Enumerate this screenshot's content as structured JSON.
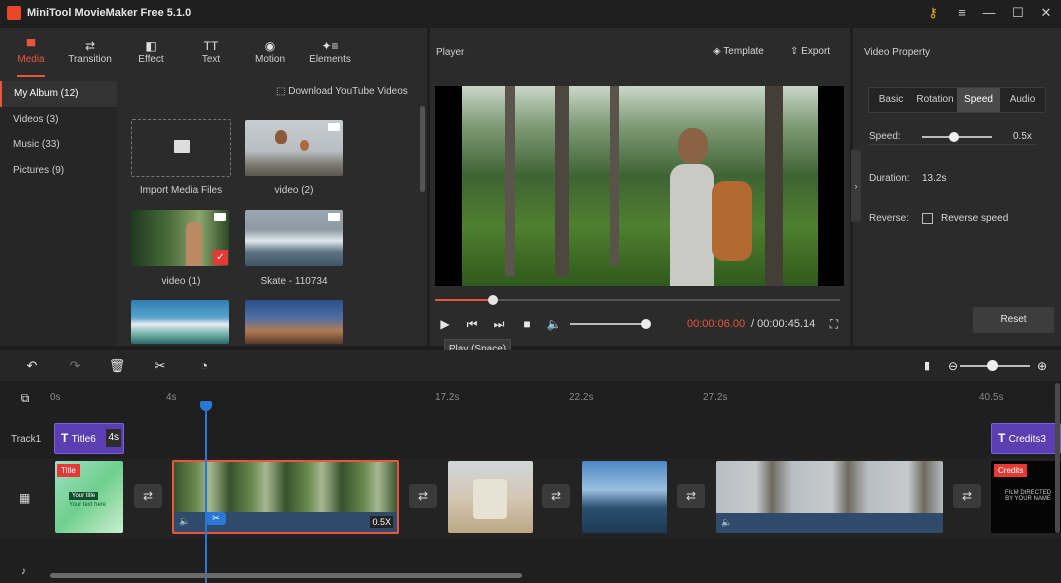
{
  "app": {
    "title": "MiniTool MovieMaker Free 5.1.0"
  },
  "window_controls": {
    "key": "⚷",
    "menu": "≡",
    "minimize": "—",
    "maximize": "☐",
    "close": "✕"
  },
  "toolbar": {
    "items": [
      {
        "label": "Media",
        "icon": "folder-icon",
        "glyph": "▀"
      },
      {
        "label": "Transition",
        "icon": "transition-arrows-icon",
        "glyph": "⇄"
      },
      {
        "label": "Effect",
        "icon": "effect-icon",
        "glyph": "◧"
      },
      {
        "label": "Text",
        "icon": "text-icon",
        "glyph": "TT"
      },
      {
        "label": "Motion",
        "icon": "motion-icon",
        "glyph": "◉"
      },
      {
        "label": "Elements",
        "icon": "elements-icon",
        "glyph": "✦≡"
      }
    ],
    "active": "Media"
  },
  "sidebar": {
    "items": [
      "My Album (12)",
      "Videos (3)",
      "Music (33)",
      "Pictures (9)"
    ]
  },
  "media": {
    "download_link": "Download YouTube Videos",
    "import_label": "Import Media Files",
    "items": [
      "video (2)",
      "video (1)",
      "Skate - 110734"
    ]
  },
  "player": {
    "label": "Player",
    "template": "Template",
    "export": "Export",
    "time_current": "00:00:06.00",
    "time_total": " / 00:00:45.14",
    "tooltip": "Play (Space)",
    "progress_fraction": 0.14
  },
  "properties": {
    "title": "Video Property",
    "tabs": [
      "Basic",
      "Rotation",
      "Speed",
      "Audio"
    ],
    "active_tab": "Speed",
    "speed_label": "Speed:",
    "speed_value": "0.5x",
    "duration_label": "Duration:",
    "duration_value": "13.2s",
    "reverse_label": "Reverse:",
    "reverse_option": "Reverse speed",
    "reset": "Reset"
  },
  "timeline": {
    "ruler": [
      "0s",
      "4s",
      "17.2s",
      "22.2s",
      "27.2s",
      "40.5s"
    ],
    "track_label": "Track1",
    "title_clip": {
      "name": "Title6",
      "duration": "4s"
    },
    "credits_clip": {
      "name": "Credits3"
    },
    "title_tag": "Title",
    "title_text_main": "Your title",
    "title_text_sub": "Your text here",
    "credits_tag": "Credits",
    "credits_text": "FILM DIRECTED\nBY YOUR NAME",
    "speed_badge": "0.5X"
  }
}
